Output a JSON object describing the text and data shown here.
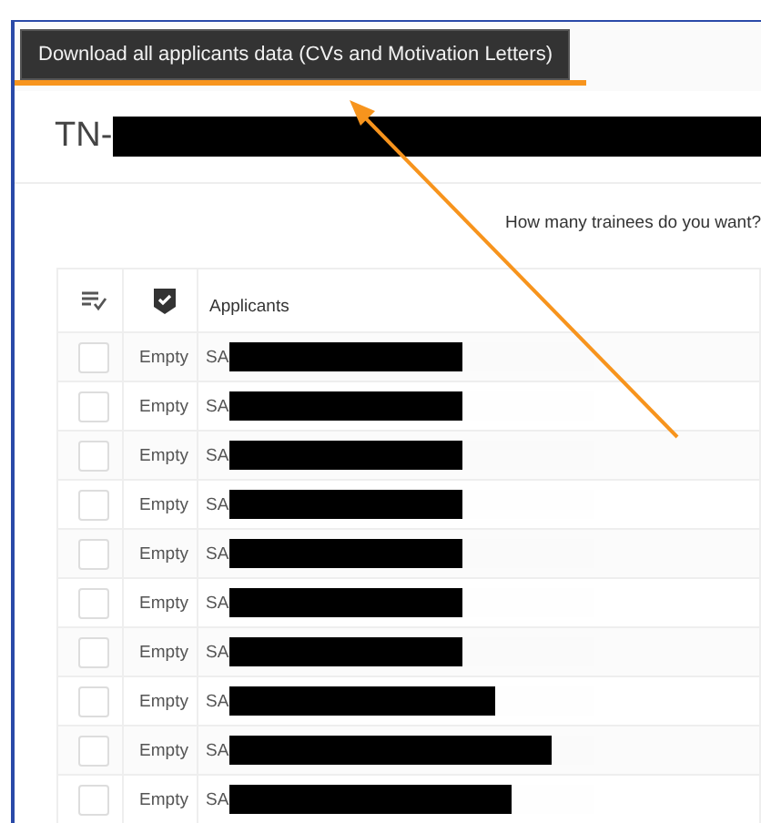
{
  "tooltip": {
    "text": "Download all applicants data (CVs and Motivation Letters)"
  },
  "annotations": {
    "underline": true,
    "arrow": true
  },
  "title": {
    "prefix": "TN-",
    "redacted": true
  },
  "trainees_prompt": "How many trainees do you want?",
  "table": {
    "columns": [
      {
        "kind": "select-icon"
      },
      {
        "kind": "badge-icon"
      },
      {
        "kind": "text",
        "label": "Applicants"
      }
    ],
    "rows": [
      {
        "checked": false,
        "status": "Empty",
        "name": "SA",
        "level": 0.64
      },
      {
        "checked": false,
        "status": "Empty",
        "name": "SA",
        "level": 0.64
      },
      {
        "checked": false,
        "status": "Empty",
        "name": "SA",
        "level": 0.64
      },
      {
        "checked": false,
        "status": "Empty",
        "name": "SA",
        "level": 0.64
      },
      {
        "checked": false,
        "status": "Empty",
        "name": "SA",
        "level": 0.64
      },
      {
        "checked": false,
        "status": "Empty",
        "name": "SA",
        "level": 0.64
      },
      {
        "checked": false,
        "status": "Empty",
        "name": "SA",
        "level": 0.64
      },
      {
        "checked": false,
        "status": "Empty",
        "name": "SA",
        "level": 0.73
      },
      {
        "checked": false,
        "status": "Empty",
        "name": "SA",
        "level": 0.885
      },
      {
        "checked": false,
        "status": "Empty",
        "name": "SA",
        "level": 0.775
      }
    ]
  }
}
